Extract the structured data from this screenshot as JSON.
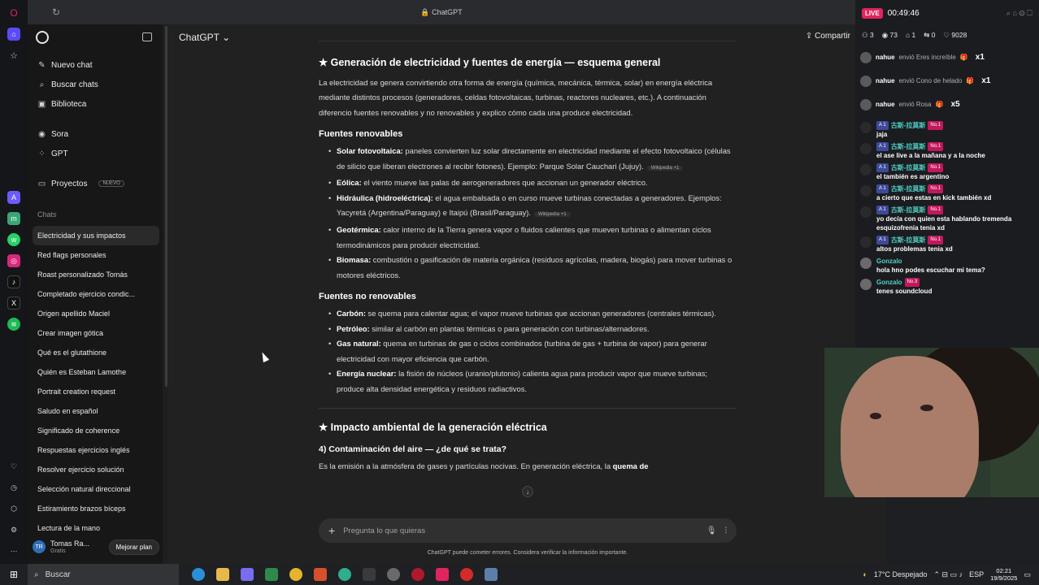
{
  "browser": {
    "url_label": "ChatGPT",
    "rail_icons": [
      "opera-icon",
      "home-icon",
      "star-icon",
      "ai-icon",
      "messenger-icon",
      "whatsapp-icon",
      "instagram-icon",
      "tiktok-icon",
      "x-icon",
      "spotify-icon",
      "heart-icon",
      "history-icon",
      "box-icon",
      "settings-icon",
      "more-icon"
    ]
  },
  "sidebar": {
    "nav": [
      {
        "icon": "edit-icon",
        "label": "Nuevo chat"
      },
      {
        "icon": "search-icon",
        "label": "Buscar chats"
      },
      {
        "icon": "library-icon",
        "label": "Biblioteca"
      },
      {
        "icon": "sora-icon",
        "label": "Sora"
      },
      {
        "icon": "gpt-icon",
        "label": "GPT"
      },
      {
        "icon": "folder-icon",
        "label": "Proyectos",
        "badge": "NUEVO"
      }
    ],
    "section_label": "Chats",
    "chats": [
      "Electricidad y sus impactos",
      "Red flags personales",
      "Roast personalizado Tomás",
      "Completado ejercicio condic...",
      "Origen apellido Maciel",
      "Crear imagen gótica",
      "Qué es el glutathione",
      "Quién es Esteban Lamothe",
      "Portrait creation request",
      "Saludo en español",
      "Significado de coherence",
      "Respuestas ejercicios inglés",
      "Resolver ejercicio solución",
      "Selección natural direccional",
      "Estiramiento brazos bíceps",
      "Lectura de la mano"
    ],
    "active_chat": 0,
    "user": {
      "initials": "TR",
      "name": "Tomas Ra...",
      "plan": "Gratis",
      "upgrade": "Mejorar plan"
    }
  },
  "header": {
    "model": "ChatGPT",
    "share": "Compartir"
  },
  "article": {
    "h_main": "★ Generación de electricidad y fuentes de energía — esquema general",
    "intro": "La electricidad se genera convirtiendo otra forma de energía (química, mecánica, térmica, solar) en energía eléctrica mediante distintos procesos (generadores, celdas fotovoltaicas, turbinas, reactores nucleares, etc.). A continuación diferencio fuentes renovables y no renovables y explico cómo cada una produce electricidad.",
    "renov_title": "Fuentes renovables",
    "renov": [
      {
        "term": "Solar fotovoltaica:",
        "text": " paneles convierten luz solar directamente en electricidad mediante el efecto fotovoltaico (células de silicio que liberan electrones al recibir fotones). Ejemplo: Parque Solar Cauchari (Jujuy).",
        "src": "Wikipedia +1"
      },
      {
        "term": "Eólica:",
        "text": " el viento mueve las palas de aerogeneradores que accionan un generador eléctrico.",
        "src": ""
      },
      {
        "term": "Hidráulica (hidroeléctrica):",
        "text": " el agua embalsada o en curso mueve turbinas conectadas a generadores. Ejemplos: Yacyretá (Argentina/Paraguay) e Itaipú (Brasil/Paraguay).",
        "src": "Wikipedia +1"
      },
      {
        "term": "Geotérmica:",
        "text": " calor interno de la Tierra genera vapor o fluidos calientes que mueven turbinas o alimentan ciclos termodinámicos para producir electricidad.",
        "src": ""
      },
      {
        "term": "Biomasa:",
        "text": " combustión o gasificación de materia orgánica (residuos agrícolas, madera, biogás) para mover turbinas o motores eléctricos.",
        "src": ""
      }
    ],
    "norenov_title": "Fuentes no renovables",
    "norenov": [
      {
        "term": "Carbón:",
        "text": " se quema para calentar agua; el vapor mueve turbinas que accionan generadores (centrales térmicas)."
      },
      {
        "term": "Petróleo:",
        "text": " similar al carbón en plantas térmicas o para generación con turbinas/alternadores."
      },
      {
        "term": "Gas natural:",
        "text": " quema en turbinas de gas o ciclos combinados (turbina de gas + turbina de vapor) para generar electricidad con mayor eficiencia que carbón."
      },
      {
        "term": "Energía nuclear:",
        "text": " la fisión de núcleos (uranio/plutonio) calienta agua para producir vapor que mueve turbinas; produce alta densidad energética y residuos radiactivos."
      }
    ],
    "h_impact": "★ Impacto ambiental de la generación eléctrica",
    "h_air": "4) Contaminación del aire — ¿de qué se trata?",
    "air_text": "Es la emisión a la atmósfera de gases y partículas nocivas. En generación eléctrica, la ",
    "air_bold": "quema de"
  },
  "composer": {
    "placeholder": "Pregunta lo que quieras",
    "disclaimer": "ChatGPT puede cometer errores. Considera verificar la información importante."
  },
  "stream": {
    "live": "LIVE",
    "time": "00:49:46",
    "stats": [
      "3",
      "73",
      "1",
      "0",
      "9028"
    ],
    "gifts": [
      {
        "user": "nahue",
        "text": "envió Eres increíble",
        "mult": "x1"
      },
      {
        "user": "nahue",
        "text": "envió Cono de helado",
        "mult": "x1"
      },
      {
        "user": "nahue",
        "text": "envió Rosa",
        "mult": "x5"
      }
    ],
    "messages": [
      {
        "name": "古斯-拉莫斯",
        "lvl": "A 1",
        "badge": "No.1",
        "text": "jaja"
      },
      {
        "name": "古斯-拉莫斯",
        "lvl": "A 1",
        "badge": "No.1",
        "text": "el ase live a la mañana y a la noche"
      },
      {
        "name": "古斯-拉莫斯",
        "lvl": "A 1",
        "badge": "No.1",
        "text": "el también es argentino"
      },
      {
        "name": "古斯-拉莫斯",
        "lvl": "A 1",
        "badge": "No.1",
        "text": "a cierto que estas en kick también xd"
      },
      {
        "name": "古斯-拉莫斯",
        "lvl": "A 1",
        "badge": "No.1",
        "text": "yo decía con quien esta hablando tremenda esquizofrenia tenia xd"
      },
      {
        "name": "古斯-拉莫斯",
        "lvl": "A 1",
        "badge": "No.1",
        "text": "altos problemas tenia xd"
      },
      {
        "name": "Gonzalo",
        "lvl": "",
        "badge": "",
        "text": "hola hno podes escuchar mi tema?"
      },
      {
        "name": "Gonzalo",
        "lvl": "",
        "badge": "No.3",
        "text": "tenes soundcloud"
      }
    ]
  },
  "taskbar": {
    "search": "Buscar",
    "weather": "17°C  Despejado",
    "lang": "ESP",
    "time": "02:21",
    "date": "19/9/2025"
  },
  "colors": {
    "accent_live": "#e0245e",
    "chat_name": "#4fd1c5",
    "active_chat_bg": "#2a2a2a"
  }
}
